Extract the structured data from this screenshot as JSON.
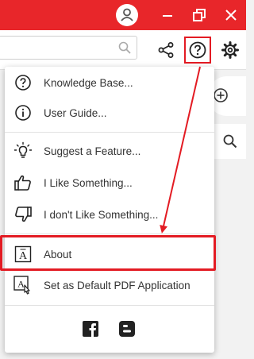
{
  "menu": {
    "items": [
      {
        "label": "Knowledge Base...",
        "icon": "question-circle-icon"
      },
      {
        "label": "User Guide...",
        "icon": "info-circle-icon"
      },
      {
        "label": "Suggest a Feature...",
        "icon": "lightbulb-icon"
      },
      {
        "label": "I Like Something...",
        "icon": "thumbs-up-icon"
      },
      {
        "label": "I don't Like Something...",
        "icon": "thumbs-down-icon"
      },
      {
        "label": "About",
        "icon": "about-icon"
      },
      {
        "label": "Set as Default PDF Application",
        "icon": "default-app-icon"
      }
    ],
    "social": [
      "facebook-icon",
      "blogger-icon"
    ]
  },
  "colors": {
    "titlebar": "#e8262a",
    "highlight": "#e31b23",
    "text": "#333333",
    "icon": "#222222"
  }
}
